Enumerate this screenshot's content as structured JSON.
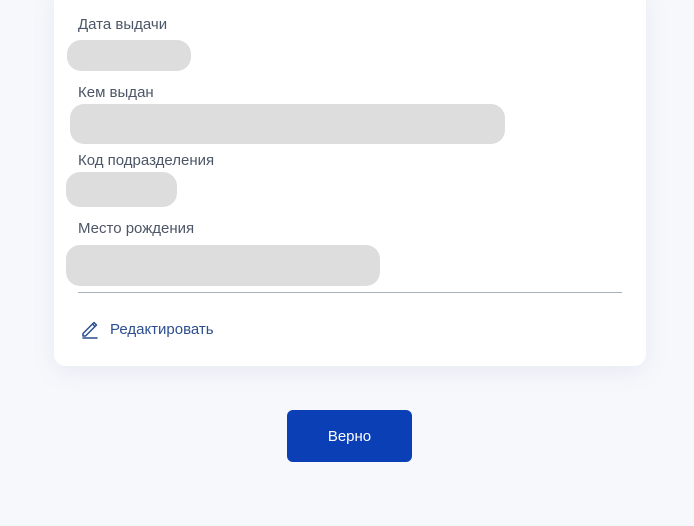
{
  "document_card": {
    "fields": [
      {
        "label": "Дата выдачи"
      },
      {
        "label": "Кем выдан"
      },
      {
        "label": "Код подразделения"
      },
      {
        "label": "Место рождения"
      }
    ],
    "edit_label": "Редактировать"
  },
  "actions": {
    "confirm_label": "Верно"
  },
  "colors": {
    "page_background": "#f6f8fc",
    "card_background": "#ffffff",
    "redacted_value": "#dddddd",
    "link": "#2c4f8f",
    "primary_button": "#0a3fb5",
    "label_text": "#4c5666"
  },
  "icons": {
    "edit": "pencil-icon"
  }
}
